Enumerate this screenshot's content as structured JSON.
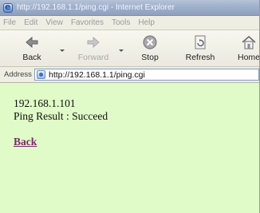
{
  "window": {
    "title": "http://192.168.1.1/ping.cgi - Internet Explorer"
  },
  "menu": {
    "items": [
      "File",
      "Edit",
      "View",
      "Favorites",
      "Tools",
      "Help"
    ]
  },
  "toolbar": {
    "buttons": [
      {
        "label": "Back",
        "icon": "back-arrow-icon",
        "enabled": true
      },
      {
        "label": "Forward",
        "icon": "forward-arrow-icon",
        "enabled": false
      },
      {
        "label": "Stop",
        "icon": "stop-icon",
        "enabled": true
      },
      {
        "label": "Refresh",
        "icon": "refresh-icon",
        "enabled": true
      },
      {
        "label": "Home",
        "icon": "home-icon",
        "enabled": true
      }
    ]
  },
  "address": {
    "label": "Address",
    "url": "http://192.168.1.1/ping.cgi"
  },
  "page": {
    "ip": "192.168.1.101",
    "result": "Ping Result : Succeed",
    "back_link": "Back"
  },
  "colors": {
    "page_background": "#e0fbc8",
    "link": "#7a2a6a",
    "title_bar": "#9fb0cc"
  }
}
